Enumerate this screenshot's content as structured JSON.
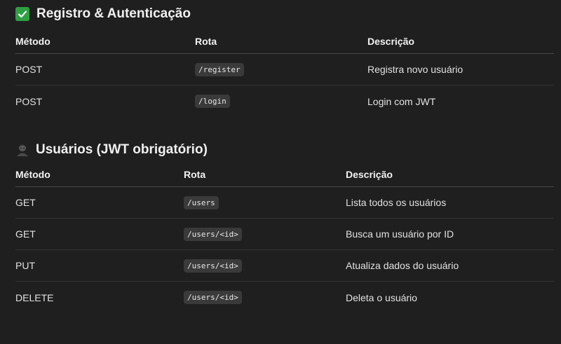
{
  "sections": [
    {
      "icon": "check-mark-icon",
      "title": "Registro & Autenticação",
      "headers": [
        "Método",
        "Rota",
        "Descrição"
      ],
      "rows": [
        {
          "method": "POST",
          "route": "/register",
          "description": "Registra novo usuário"
        },
        {
          "method": "POST",
          "route": "/login",
          "description": "Login com JWT"
        }
      ]
    },
    {
      "icon": "user-icon",
      "title": "Usuários (JWT obrigatório)",
      "headers": [
        "Método",
        "Rota",
        "Descrição"
      ],
      "rows": [
        {
          "method": "GET",
          "route": "/users",
          "description": "Lista todos os usuários"
        },
        {
          "method": "GET",
          "route": "/users/<id>",
          "description": "Busca um usuário por ID"
        },
        {
          "method": "PUT",
          "route": "/users/<id>",
          "description": "Atualiza dados do usuário"
        },
        {
          "method": "DELETE",
          "route": "/users/<id>",
          "description": "Deleta o usuário"
        }
      ]
    }
  ],
  "colors": {
    "background": "#1f1f1f",
    "check_green": "#2ea043",
    "code_background": "#3a3a3a"
  }
}
